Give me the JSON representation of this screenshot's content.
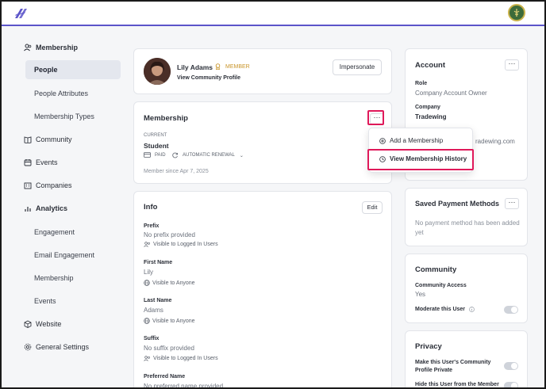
{
  "sidebar": {
    "membership_header": "Membership",
    "people": "People",
    "people_attributes": "People Attributes",
    "membership_types": "Membership Types",
    "community": "Community",
    "events": "Events",
    "companies": "Companies",
    "analytics": "Analytics",
    "engagement": "Engagement",
    "email_engagement": "Email Engagement",
    "analytics_membership": "Membership",
    "analytics_events": "Events",
    "website": "Website",
    "general_settings": "General Settings"
  },
  "profile": {
    "name": "Lily Adams",
    "badge": "MEMBER",
    "link": "View Community Profile",
    "impersonate": "Impersonate"
  },
  "membership": {
    "title": "Membership",
    "current_label": "CURRENT",
    "plan": "Student",
    "paid": "PAID",
    "renewal": "AUTOMATIC RENEWAL",
    "since": "Member since Apr 7, 2025",
    "menu_dots": "···",
    "dropdown": {
      "add": "Add a Membership",
      "history": "View Membership History"
    }
  },
  "info": {
    "title": "Info",
    "edit": "Edit",
    "fields": [
      {
        "label": "Prefix",
        "value": "No prefix provided",
        "visibility": "Visible to Logged In Users"
      },
      {
        "label": "First Name",
        "value": "Lily",
        "visibility": "Visible to Anyone"
      },
      {
        "label": "Last Name",
        "value": "Adams",
        "visibility": "Visible to Anyone"
      },
      {
        "label": "Suffix",
        "value": "No suffix provided",
        "visibility": "Visible to Logged In Users"
      },
      {
        "label": "Preferred Name",
        "value": "No preferred name provided",
        "visibility": ""
      }
    ]
  },
  "account": {
    "title": "Account",
    "dots": "···",
    "role_label": "Role",
    "role_value": "Company Account Owner",
    "company_label": "Company",
    "company_value": "Tradewing",
    "email_partial": "radewing.com"
  },
  "payment": {
    "title": "Saved Payment Methods",
    "dots": "···",
    "empty": "No payment method has been added yet"
  },
  "community": {
    "title": "Community",
    "access_label": "Community Access",
    "access_value": "Yes",
    "moderate": "Moderate this User"
  },
  "privacy": {
    "title": "Privacy",
    "private_profile": "Make this User's Community Profile Private",
    "hide_user": "Hide this User from the Member"
  },
  "colors": {
    "accent": "#5b54c9",
    "highlight": "#e0195a",
    "badge": "#c9952a"
  }
}
